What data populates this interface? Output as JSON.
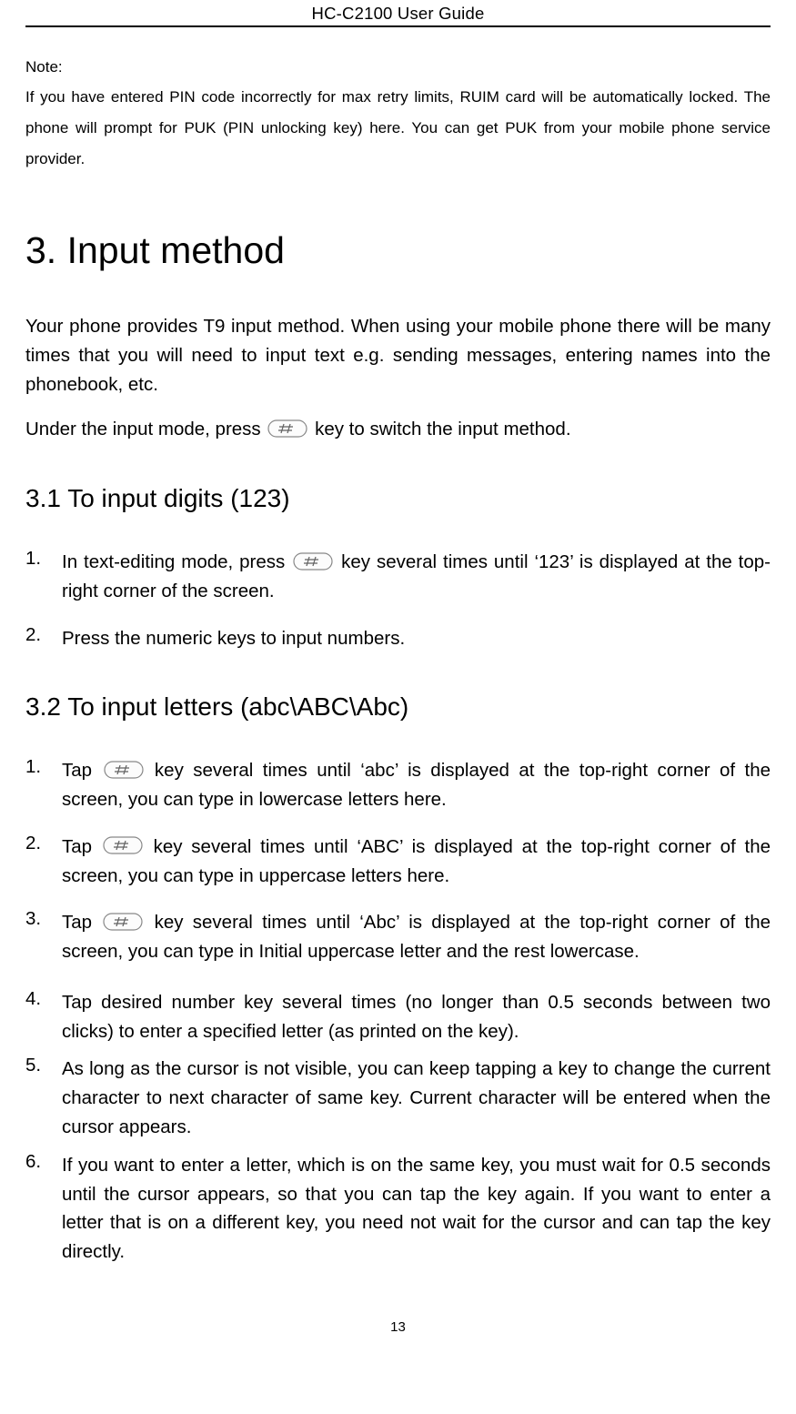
{
  "header": {
    "title": "HC-C2100 User Guide"
  },
  "note": {
    "label": "Note:",
    "body": "If you have entered PIN code incorrectly for max retry limits, RUIM card will be automatically locked. The phone will prompt for PUK (PIN unlocking key) here. You can get PUK from your mobile phone service provider."
  },
  "section3": {
    "heading": "3. Input method",
    "intro": "Your phone provides T9 input method. When using your mobile phone there will be many times that you will need to input text e.g. sending messages, entering names into the phonebook, etc.",
    "undermode_before": "Under the input mode, press ",
    "undermode_after": " key to switch the input method."
  },
  "section31": {
    "heading": "3.1 To input digits (123)",
    "items": [
      {
        "num": "1.",
        "before": "In text-editing mode, press ",
        "after": " key several times until ‘123’ is displayed at the top-right corner of the screen."
      },
      {
        "num": "2.",
        "text": "Press the numeric keys to input numbers."
      }
    ]
  },
  "section32": {
    "heading": "3.2 To input letters (abc\\ABC\\Abc)",
    "items": [
      {
        "num": "1.",
        "before": "Tap ",
        "after": " key several times until ‘abc’ is displayed at the top-right corner of the screen, you can type in lowercase letters here."
      },
      {
        "num": "2.",
        "before": "Tap ",
        "after": " key several times until ‘ABC’ is displayed at the top-right corner of the screen, you can type in uppercase letters here."
      },
      {
        "num": "3.",
        "before": "Tap ",
        "after": " key several times until ‘Abc’ is displayed at the top-right corner of the screen, you can type in Initial uppercase letter and the rest lowercase."
      },
      {
        "num": "4.",
        "text": "Tap desired number key several times (no longer than 0.5 seconds between two clicks) to enter a specified letter (as printed on the key)."
      },
      {
        "num": "5.",
        "text": "As long as the cursor is not visible, you can keep tapping a key to change the current character to next character of same key. Current character will be entered when the cursor appears."
      },
      {
        "num": "6.",
        "text": "If you want to enter a letter, which is on the same key, you must wait for 0.5 seconds until the cursor appears, so that you can tap the key again. If you want to enter a letter that is on a different key, you need not wait for the cursor and can tap the key directly."
      }
    ]
  },
  "footer": {
    "page": "13"
  },
  "icons": {
    "hash_key": "hash-key-icon"
  }
}
